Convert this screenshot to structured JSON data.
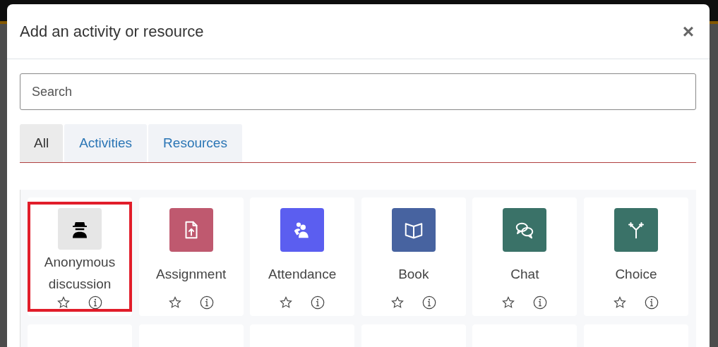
{
  "dialog": {
    "title": "Add an activity or resource",
    "close": "×",
    "search": {
      "placeholder": "Search"
    },
    "tabs": [
      {
        "label": "All",
        "selected": true
      },
      {
        "label": "Activities",
        "selected": false
      },
      {
        "label": "Resources",
        "selected": false
      }
    ],
    "items": [
      {
        "name": "Anonymous discussion",
        "color": "#e6e6e6",
        "highlighted": true
      },
      {
        "name": "Assignment",
        "color": "#bf596f",
        "highlighted": false
      },
      {
        "name": "Attendance",
        "color": "#5b5ef0",
        "highlighted": false
      },
      {
        "name": "Book",
        "color": "#4763a0",
        "highlighted": false
      },
      {
        "name": "Chat",
        "color": "#3a7268",
        "highlighted": false
      },
      {
        "name": "Choice",
        "color": "#3a7268",
        "highlighted": false
      }
    ]
  }
}
